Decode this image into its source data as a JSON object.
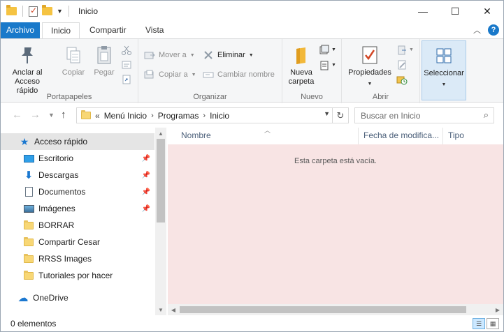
{
  "window": {
    "title": "Inicio",
    "controls": {
      "minimize": "—",
      "maximize": "☐",
      "close": "✕"
    }
  },
  "ribbon_tabs": {
    "file": "Archivo",
    "home": "Inicio",
    "share": "Compartir",
    "view": "Vista"
  },
  "ribbon": {
    "clipboard": {
      "label": "Portapapeles",
      "pin": "Anclar al\nAcceso rápido",
      "copy": "Copiar",
      "paste": "Pegar"
    },
    "organize": {
      "label": "Organizar",
      "move_to": "Mover a",
      "copy_to": "Copiar a",
      "delete": "Eliminar",
      "rename": "Cambiar nombre"
    },
    "new": {
      "label": "Nuevo",
      "new_folder": "Nueva\ncarpeta"
    },
    "open": {
      "label": "Abrir",
      "properties": "Propiedades"
    },
    "select": {
      "label": "Seleccionar"
    }
  },
  "address": {
    "crumbs": [
      "Menú Inicio",
      "Programas",
      "Inicio"
    ],
    "overflow": "«"
  },
  "search": {
    "placeholder": "Buscar en Inicio"
  },
  "nav": {
    "quick_access": "Acceso rápido",
    "items": [
      {
        "label": "Escritorio",
        "icon": "desktop-icon",
        "pinned": true
      },
      {
        "label": "Descargas",
        "icon": "download-icon",
        "pinned": true
      },
      {
        "label": "Documentos",
        "icon": "documents-icon",
        "pinned": true
      },
      {
        "label": "Imágenes",
        "icon": "pictures-icon",
        "pinned": true
      },
      {
        "label": "BORRAR",
        "icon": "folder-icon",
        "pinned": false
      },
      {
        "label": "Compartir Cesar",
        "icon": "folder-icon",
        "pinned": false
      },
      {
        "label": "RRSS Images",
        "icon": "folder-icon",
        "pinned": false
      },
      {
        "label": "Tutoriales por hacer",
        "icon": "folder-icon",
        "pinned": false
      }
    ],
    "onedrive": "OneDrive"
  },
  "columns": {
    "name": "Nombre",
    "date": "Fecha de modifica...",
    "type": "Tipo"
  },
  "content": {
    "empty_message": "Esta carpeta está vacía."
  },
  "status": {
    "items": "0 elementos"
  },
  "colors": {
    "accent": "#1979ca",
    "selected": "#cce8ff",
    "empty_area": "#f8e4e4"
  }
}
